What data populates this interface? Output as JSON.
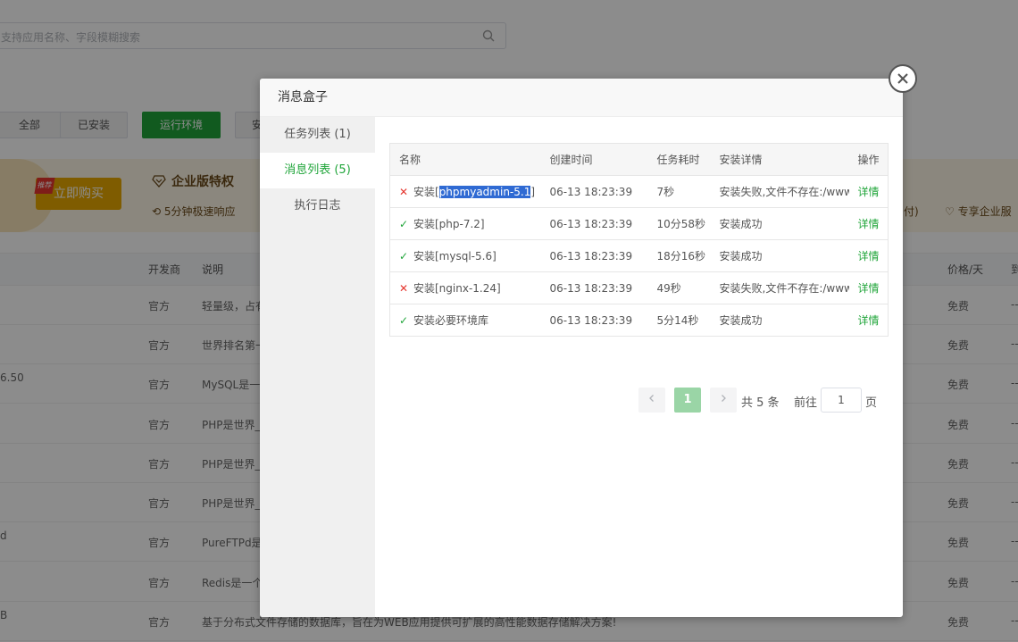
{
  "background": {
    "search_placeholder": "支持应用名称、字段模糊搜索",
    "filters": [
      "全部",
      "已安装",
      "运行环境",
      "安"
    ],
    "promo": {
      "badge": "推荐",
      "buy_label": "立即购买",
      "title": "企业版特权",
      "feature": "5分钟极速响应",
      "right_fragment": "付)",
      "right_feature": "专享企业服"
    },
    "headers": {
      "developer": "开发商",
      "desc": "说明",
      "price": "价格/天",
      "extra": "到"
    },
    "rows": [
      {
        "name": "",
        "dev": "官方",
        "desc": "轻量级，占有",
        "price": "免费",
        "extra": "--"
      },
      {
        "name": "",
        "dev": "官方",
        "desc": "世界排名第一",
        "price": "免费",
        "extra": "--"
      },
      {
        "name": "6.50",
        "dev": "官方",
        "desc": "MySQL是一",
        "price": "免费",
        "extra": "--"
      },
      {
        "name": "",
        "dev": "官方",
        "desc": "PHP是世界_",
        "price": "免费",
        "extra": "--"
      },
      {
        "name": "",
        "dev": "官方",
        "desc": "PHP是世界_",
        "price": "免费",
        "extra": "--"
      },
      {
        "name": "",
        "dev": "官方",
        "desc": "PHP是世界_",
        "price": "免费",
        "extra": "--"
      },
      {
        "name": "d",
        "dev": "官方",
        "desc": "PureFTPd是",
        "price": "免费",
        "extra": "--"
      },
      {
        "name": "",
        "dev": "官方",
        "desc": "Redis是一个",
        "price": "免费",
        "extra": "--"
      },
      {
        "name": "B",
        "dev": "官方",
        "desc": "基于分布式文件存储的数据库，旨在为WEB应用提供可扩展的高性能数据存储解决方案!",
        "price": "免费",
        "extra": "--"
      }
    ]
  },
  "modal": {
    "title": "消息盒子",
    "sidebar": [
      {
        "label": "任务列表 (1)",
        "active": false
      },
      {
        "label": "消息列表 (5)",
        "active": true
      },
      {
        "label": "执行日志",
        "active": false
      }
    ],
    "table": {
      "headers": [
        "名称",
        "创建时间",
        "任务耗时",
        "安装详情",
        "操作"
      ],
      "rows": [
        {
          "status": "fail",
          "prefix": "安装[",
          "selected": "phpmyadmin-5.1",
          "suffix": "]",
          "time": "06-13 18:23:39",
          "duration": "7秒",
          "detail": "安装失败,文件不存在:/www",
          "op": "详情"
        },
        {
          "status": "ok",
          "prefix": "安装[php-7.2]",
          "selected": "",
          "suffix": "",
          "time": "06-13 18:23:39",
          "duration": "10分58秒",
          "detail": "安装成功",
          "op": "详情"
        },
        {
          "status": "ok",
          "prefix": "安装[mysql-5.6]",
          "selected": "",
          "suffix": "",
          "time": "06-13 18:23:39",
          "duration": "18分16秒",
          "detail": "安装成功",
          "op": "详情"
        },
        {
          "status": "fail",
          "prefix": "安装[nginx-1.24]",
          "selected": "",
          "suffix": "",
          "time": "06-13 18:23:39",
          "duration": "49秒",
          "detail": "安装失败,文件不存在:/www",
          "op": "详情"
        },
        {
          "status": "ok",
          "prefix": "安装必要环境库",
          "selected": "",
          "suffix": "",
          "time": "06-13 18:23:39",
          "duration": "5分14秒",
          "detail": "安装成功",
          "op": "详情"
        }
      ]
    },
    "pagination": {
      "current": "1",
      "total_text": "共 5 条",
      "goto_label": "前往",
      "goto_value": "1",
      "page_suffix": "页"
    }
  },
  "colors": {
    "accent": "#20a53a",
    "error": "#e5362f",
    "selection": "#2f6ad3"
  }
}
